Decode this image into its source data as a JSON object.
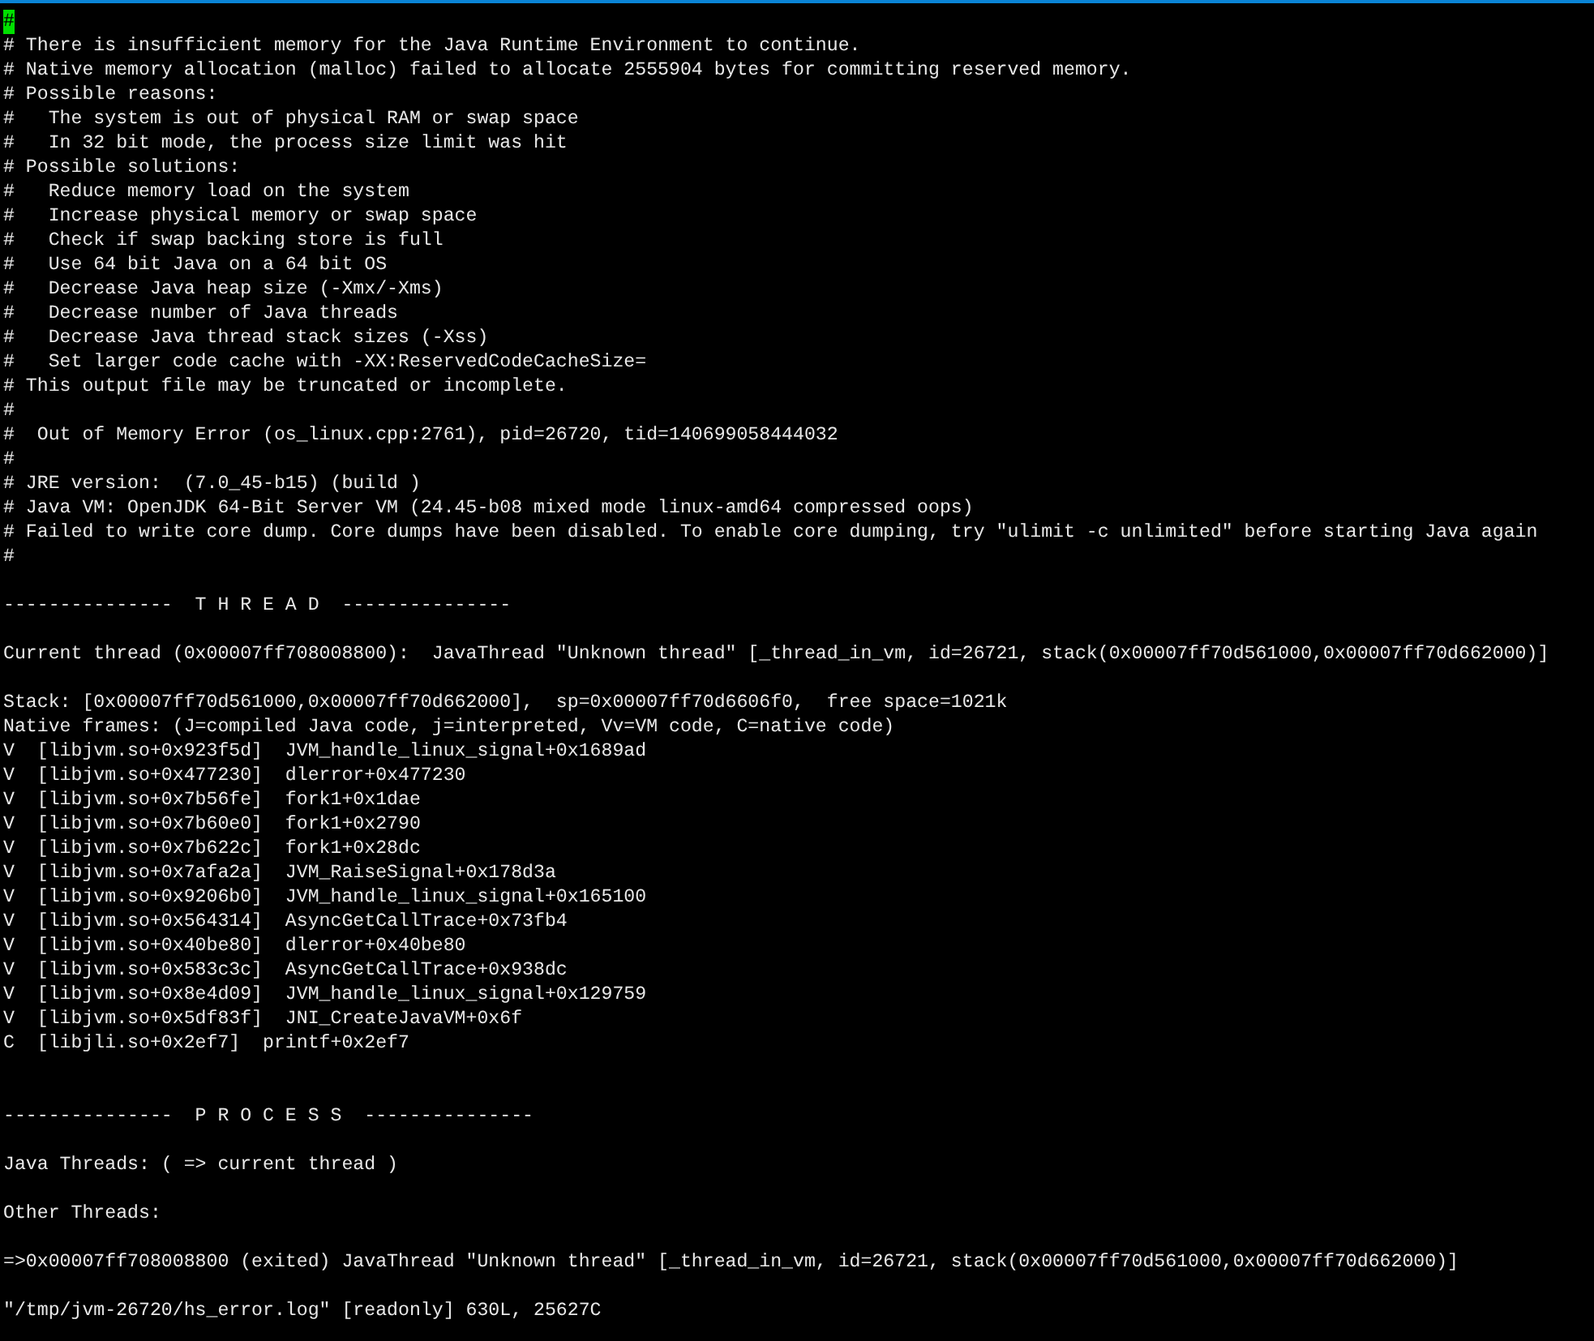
{
  "terminal": {
    "lines": [
      {
        "kind": "cursor",
        "text": "#"
      },
      {
        "kind": "text",
        "text": "# There is insufficient memory for the Java Runtime Environment to continue."
      },
      {
        "kind": "text",
        "text": "# Native memory allocation (malloc) failed to allocate 2555904 bytes for committing reserved memory."
      },
      {
        "kind": "text",
        "text": "# Possible reasons:"
      },
      {
        "kind": "text",
        "text": "#   The system is out of physical RAM or swap space"
      },
      {
        "kind": "text",
        "text": "#   In 32 bit mode, the process size limit was hit"
      },
      {
        "kind": "text",
        "text": "# Possible solutions:"
      },
      {
        "kind": "text",
        "text": "#   Reduce memory load on the system"
      },
      {
        "kind": "text",
        "text": "#   Increase physical memory or swap space"
      },
      {
        "kind": "text",
        "text": "#   Check if swap backing store is full"
      },
      {
        "kind": "text",
        "text": "#   Use 64 bit Java on a 64 bit OS"
      },
      {
        "kind": "text",
        "text": "#   Decrease Java heap size (-Xmx/-Xms)"
      },
      {
        "kind": "text",
        "text": "#   Decrease number of Java threads"
      },
      {
        "kind": "text",
        "text": "#   Decrease Java thread stack sizes (-Xss)"
      },
      {
        "kind": "text",
        "text": "#   Set larger code cache with -XX:ReservedCodeCacheSize="
      },
      {
        "kind": "text",
        "text": "# This output file may be truncated or incomplete."
      },
      {
        "kind": "text",
        "text": "#"
      },
      {
        "kind": "text",
        "text": "#  Out of Memory Error (os_linux.cpp:2761), pid=26720, tid=140699058444032"
      },
      {
        "kind": "text",
        "text": "#"
      },
      {
        "kind": "text",
        "text": "# JRE version:  (7.0_45-b15) (build )"
      },
      {
        "kind": "text",
        "text": "# Java VM: OpenJDK 64-Bit Server VM (24.45-b08 mixed mode linux-amd64 compressed oops)"
      },
      {
        "kind": "text",
        "text": "# Failed to write core dump. Core dumps have been disabled. To enable core dumping, try \"ulimit -c unlimited\" before starting Java again"
      },
      {
        "kind": "text",
        "text": "#"
      },
      {
        "kind": "blank"
      },
      {
        "kind": "text",
        "text": "---------------  T H R E A D  ---------------"
      },
      {
        "kind": "blank"
      },
      {
        "kind": "text",
        "text": "Current thread (0x00007ff708008800):  JavaThread \"Unknown thread\" [_thread_in_vm, id=26721, stack(0x00007ff70d561000,0x00007ff70d662000)]"
      },
      {
        "kind": "blank"
      },
      {
        "kind": "text",
        "text": "Stack: [0x00007ff70d561000,0x00007ff70d662000],  sp=0x00007ff70d6606f0,  free space=1021k"
      },
      {
        "kind": "text",
        "text": "Native frames: (J=compiled Java code, j=interpreted, Vv=VM code, C=native code)"
      },
      {
        "kind": "text",
        "text": "V  [libjvm.so+0x923f5d]  JVM_handle_linux_signal+0x1689ad"
      },
      {
        "kind": "text",
        "text": "V  [libjvm.so+0x477230]  dlerror+0x477230"
      },
      {
        "kind": "text",
        "text": "V  [libjvm.so+0x7b56fe]  fork1+0x1dae"
      },
      {
        "kind": "text",
        "text": "V  [libjvm.so+0x7b60e0]  fork1+0x2790"
      },
      {
        "kind": "text",
        "text": "V  [libjvm.so+0x7b622c]  fork1+0x28dc"
      },
      {
        "kind": "text",
        "text": "V  [libjvm.so+0x7afa2a]  JVM_RaiseSignal+0x178d3a"
      },
      {
        "kind": "text",
        "text": "V  [libjvm.so+0x9206b0]  JVM_handle_linux_signal+0x165100"
      },
      {
        "kind": "text",
        "text": "V  [libjvm.so+0x564314]  AsyncGetCallTrace+0x73fb4"
      },
      {
        "kind": "text",
        "text": "V  [libjvm.so+0x40be80]  dlerror+0x40be80"
      },
      {
        "kind": "text",
        "text": "V  [libjvm.so+0x583c3c]  AsyncGetCallTrace+0x938dc"
      },
      {
        "kind": "text",
        "text": "V  [libjvm.so+0x8e4d09]  JVM_handle_linux_signal+0x129759"
      },
      {
        "kind": "text",
        "text": "V  [libjvm.so+0x5df83f]  JNI_CreateJavaVM+0x6f"
      },
      {
        "kind": "text",
        "text": "C  [libjli.so+0x2ef7]  printf+0x2ef7"
      },
      {
        "kind": "blank"
      },
      {
        "kind": "blank"
      },
      {
        "kind": "text",
        "text": "---------------  P R O C E S S  ---------------"
      },
      {
        "kind": "blank"
      },
      {
        "kind": "text",
        "text": "Java Threads: ( => current thread )"
      },
      {
        "kind": "blank"
      },
      {
        "kind": "text",
        "text": "Other Threads:"
      },
      {
        "kind": "blank"
      },
      {
        "kind": "text",
        "text": "=>0x00007ff708008800 (exited) JavaThread \"Unknown thread\" [_thread_in_vm, id=26721, stack(0x00007ff70d561000,0x00007ff70d662000)]"
      },
      {
        "kind": "blank"
      },
      {
        "kind": "text",
        "text": "\"/tmp/jvm-26720/hs_error.log\" [readonly] 630L, 25627C"
      }
    ]
  }
}
